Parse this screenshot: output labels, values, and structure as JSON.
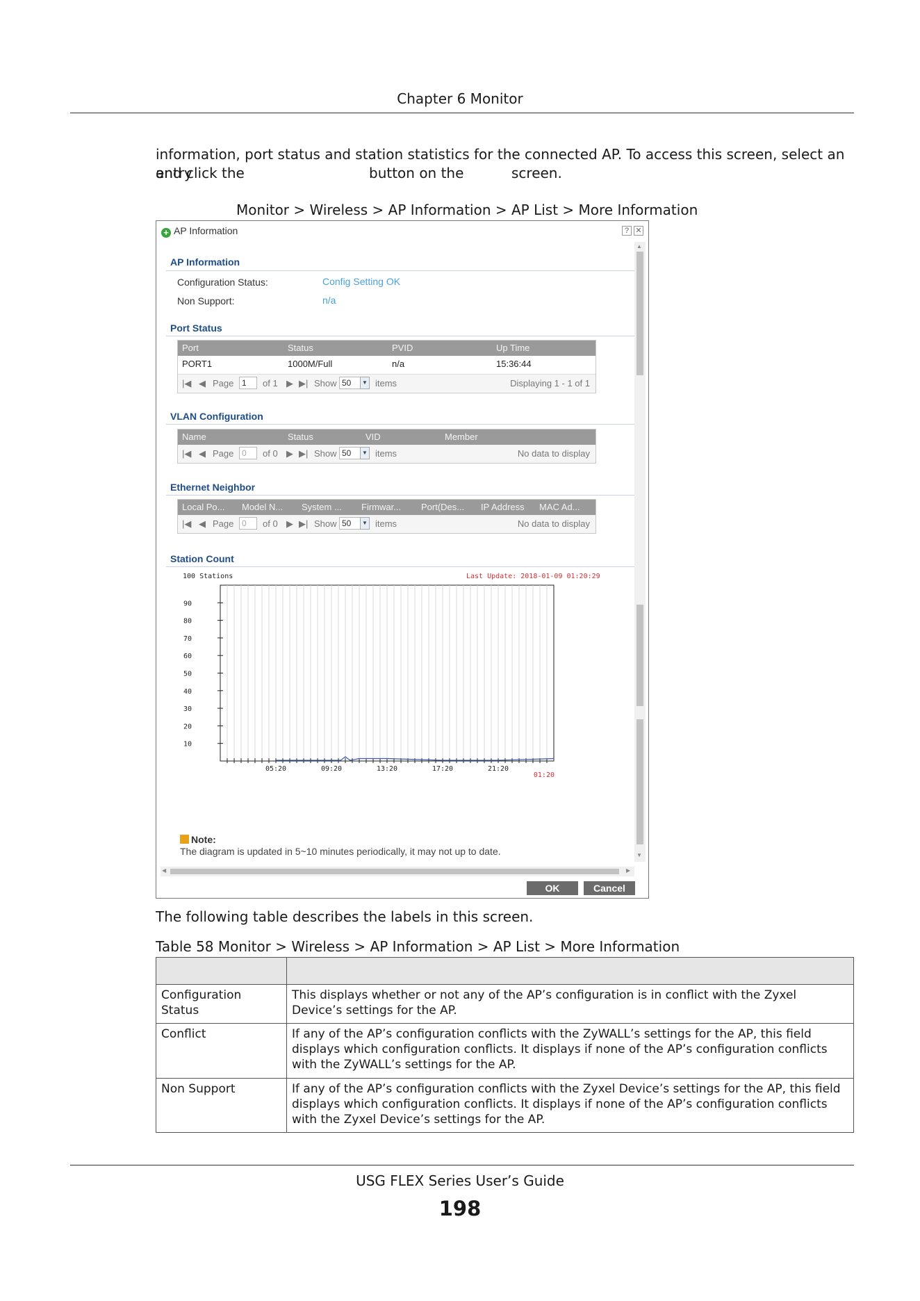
{
  "header": {
    "chapter": "Chapter 6 Monitor"
  },
  "intro": {
    "line1": "information, port status and station statistics for the connected AP. To access this screen, select an entry",
    "line2_a": "and click the",
    "line2_b": "button on the",
    "line2_c": "screen."
  },
  "figure_caption": "Monitor > Wireless > AP Information > AP List > More Information",
  "window": {
    "title": "AP Information",
    "help_glyph": "?",
    "close_glyph": "✕",
    "ap_info": {
      "title": "AP Information",
      "config_status_label": "Configuration Status:",
      "config_status_value": "Config Setting OK",
      "non_support_label": "Non Support:",
      "non_support_value": "n/a"
    },
    "port_status": {
      "title": "Port Status",
      "columns": [
        "Port",
        "Status",
        "PVID",
        "Up Time"
      ],
      "rows": [
        [
          "PORT1",
          "1000M/Full",
          "n/a",
          "15:36:44"
        ]
      ],
      "pager": {
        "page_label": "Page",
        "page_value": "1",
        "of_label": "of 1",
        "show_label": "Show",
        "show_value": "50",
        "items_label": "items",
        "display_text": "Displaying 1 - 1 of 1"
      }
    },
    "vlan": {
      "title": "VLAN Configuration",
      "columns": [
        "Name",
        "Status",
        "VID",
        "Member"
      ],
      "pager": {
        "page_label": "Page",
        "page_value": "0",
        "of_label": "of 0",
        "show_label": "Show",
        "show_value": "50",
        "items_label": "items",
        "display_text": "No data to display"
      }
    },
    "ethernet_neighbor": {
      "title": "Ethernet Neighbor",
      "columns": [
        "Local Po...",
        "Model N...",
        "System ...",
        "Firmwar...",
        "Port(Des...",
        "IP Address",
        "MAC Ad..."
      ],
      "pager": {
        "page_label": "Page",
        "page_value": "0",
        "of_label": "of 0",
        "show_label": "Show",
        "show_value": "50",
        "items_label": "items",
        "display_text": "No data to display"
      }
    },
    "station_count": {
      "title": "Station Count",
      "max_label": "100 Stations",
      "last_update": "Last Update: 2018-01-09 01:20:29",
      "current_time_label": "01:20"
    },
    "note": {
      "title": "Note:",
      "text": "The diagram is updated in 5~10 minutes periodically, it may not up to date."
    },
    "ok_label": "OK",
    "cancel_label": "Cancel"
  },
  "chart_data": {
    "type": "line",
    "title": "Station Count",
    "ylabel": "100 Stations",
    "ylim": [
      0,
      100
    ],
    "yticks": [
      10,
      20,
      30,
      40,
      50,
      60,
      70,
      80,
      90
    ],
    "xticks": [
      "05:20",
      "09:20",
      "13:20",
      "17:20",
      "21:20"
    ],
    "grid": true,
    "series": [
      {
        "x": [
          "05:20",
          "07:00",
          "08:40",
          "09:20",
          "10:00",
          "10:20",
          "10:40",
          "11:20",
          "13:20",
          "17:20",
          "21:20",
          "01:20"
        ],
        "values": [
          0,
          0,
          0,
          0,
          0,
          2,
          0,
          1,
          1,
          0,
          0,
          1
        ]
      }
    ],
    "colors": {
      "line": "#3b5bb5",
      "grid": "#d8d8d8",
      "last_update": "#d03030"
    }
  },
  "after_figure_text": "The following table describes the labels in this screen.",
  "table": {
    "caption": "Table 58   Monitor > Wireless > AP Information > AP List > More Information",
    "rows": [
      {
        "label": "Configuration Status",
        "description": "This displays whether or not any of the AP’s configuration is in conflict with the Zyxel Device’s settings for the AP."
      },
      {
        "label": "Conflict",
        "description": "If any of the AP’s configuration conflicts with the ZyWALL’s settings for the AP, this field displays which configuration conflicts. It displays        if none of the AP’s configuration conflicts with the ZyWALL’s settings for the AP."
      },
      {
        "label": "Non Support",
        "description": "If any of the AP’s configuration conflicts with the Zyxel Device’s settings for the AP, this field displays which configuration conflicts. It displays        if none of the AP’s configuration conflicts with the Zyxel Device’s settings for the AP."
      }
    ]
  },
  "footer": {
    "guide_title": "USG FLEX Series User’s Guide",
    "page_number": "198"
  }
}
